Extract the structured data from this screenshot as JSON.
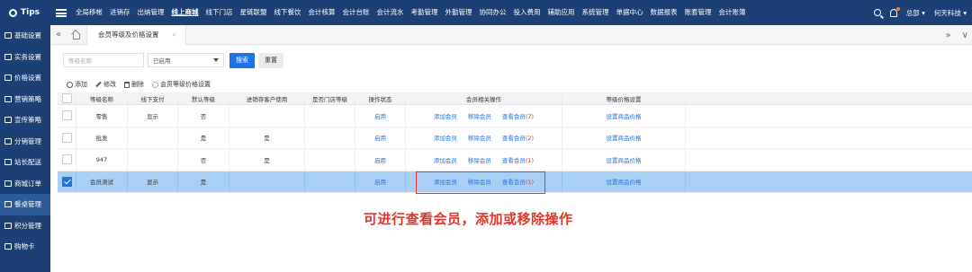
{
  "topnav": {
    "brand": "Tips",
    "menu": [
      "全局移帐",
      "进销存",
      "出纳管理",
      "线上商城",
      "线下门店",
      "星链联盟",
      "线下餐饮",
      "会计核算",
      "会计台账",
      "会计流水",
      "考勤管理",
      "外勤管理",
      "协同办公",
      "投入费用",
      "辅助应用",
      "系统管理",
      "单据中心",
      "数据报表",
      "账套管理",
      "会计账簿"
    ],
    "active_menu": "线上商城",
    "user_company": "总部 ▾",
    "user_name": "何天科技 ▾",
    "colors": {
      "nav_bg": "#1c3f75",
      "accent": "#1f73e6",
      "highlight": "#e0362b"
    }
  },
  "sidebar": {
    "items": [
      {
        "label": "基础设置",
        "icon": "settings-icon"
      },
      {
        "label": "实务设置",
        "icon": "diamond-icon"
      },
      {
        "label": "价格设置",
        "icon": "tag-icon"
      },
      {
        "label": "营销策略",
        "icon": "doc-icon"
      },
      {
        "label": "宣传策略",
        "icon": "doc-icon"
      },
      {
        "label": "分销管理",
        "icon": "doc-icon"
      },
      {
        "label": "站长配送",
        "icon": "doc-icon"
      },
      {
        "label": "商城订单",
        "icon": "order-icon"
      },
      {
        "label": "餐桌管理",
        "icon": "doc-icon"
      },
      {
        "label": "积分管理",
        "icon": "doc-icon"
      },
      {
        "label": "购物卡",
        "icon": "doc-icon"
      }
    ]
  },
  "tabbar": {
    "prev": "«",
    "tab_label": "会员等级及价格设置",
    "tab_close": "×",
    "next": "»",
    "dropdown": "∨"
  },
  "filters": {
    "name_placeholder": "等级名称",
    "status_value": "已启用",
    "search_label": "搜索",
    "reset_label": "重置"
  },
  "toolbar": {
    "add": "添加",
    "edit": "修改",
    "delete": "删除",
    "price_setting": "会员等级价格设置"
  },
  "table": {
    "headers": [
      "等级名称",
      "线下支付",
      "默认等级",
      "进销存客户使用",
      "是否门店等级",
      "操作状态",
      "会员相关操作",
      "等级价格设置"
    ],
    "rows": [
      {
        "name": "零售",
        "offline_pay": "显示",
        "default": "否",
        "erp_use": "",
        "store": "",
        "status": "启用",
        "add": "添加会员",
        "remove": "移除会员",
        "view": "查看会员",
        "count": "(7)",
        "price": "设置商品价格",
        "checked": false
      },
      {
        "name": "批发",
        "offline_pay": "",
        "default": "是",
        "erp_use": "是",
        "store": "",
        "status": "启用",
        "add": "添加会员",
        "remove": "移除会员",
        "view": "查看会员",
        "count": "(2)",
        "price": "设置商品价格",
        "checked": false
      },
      {
        "name": "947",
        "offline_pay": "",
        "default": "否",
        "erp_use": "是",
        "store": "",
        "status": "启用",
        "add": "添加会员",
        "remove": "移除会员",
        "view": "查看会员",
        "count": "(1)",
        "price": "设置商品价格",
        "checked": false
      },
      {
        "name": "会员测试",
        "offline_pay": "显示",
        "default": "是",
        "erp_use": "",
        "store": "",
        "status": "启用",
        "add": "添加会员",
        "remove": "移除会员",
        "view": "查看会员",
        "count": "(1)",
        "price": "设置商品价格",
        "checked": true
      }
    ]
  },
  "annotation": "可进行查看会员，添加或移除操作"
}
